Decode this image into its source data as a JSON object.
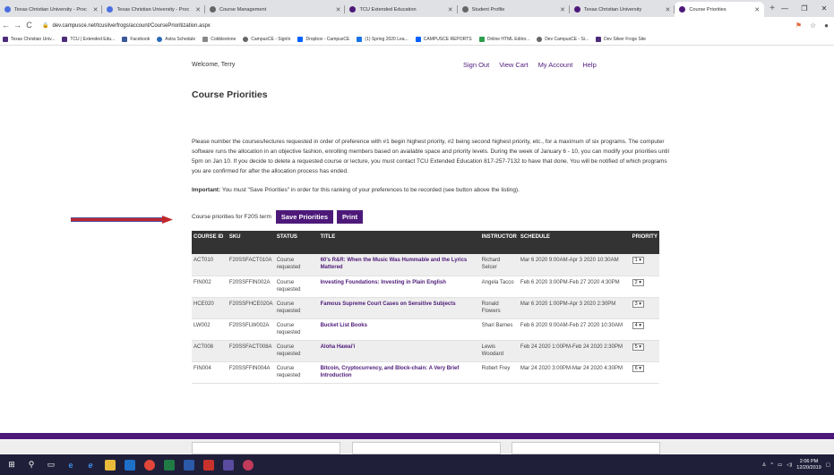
{
  "browser": {
    "tabs": [
      {
        "label": "Texas Christian University - Proc",
        "active": false
      },
      {
        "label": "Texas Christian University - Proc",
        "active": false
      },
      {
        "label": "Course Management",
        "active": false
      },
      {
        "label": "TCU Extended Education",
        "active": false
      },
      {
        "label": "Student Profile",
        "active": false
      },
      {
        "label": "Texas Christian University",
        "active": false
      },
      {
        "label": "Course Priorities",
        "active": true
      }
    ],
    "url": "dev.campusce.net/tcusilverfrogs/account/CoursePrioritization.aspx",
    "bookmarks": [
      "Texas Christian Univ...",
      "TCU | Extended Edu...",
      "Facebook",
      "Astra Schedule",
      "Cobblestone",
      "CampusCE - SignIn",
      "Dropbox - CampusCE",
      "(1) Spring 2020 Lea...",
      "CAMPUSCE REPORTS",
      "Online HTML Editor...",
      "Dev CampusCE - Si...",
      "Dev Silver Frogs Site"
    ]
  },
  "header": {
    "welcome": "Welcome, Terry",
    "nav": [
      "Sign Out",
      "View Cart",
      "My Account",
      "Help"
    ]
  },
  "page": {
    "title": "Course Priorities",
    "intro": "Please number the courses/lectures requested in order of preference with #1 begin highest priority, #2 being second highest priority, etc., for a maximum of six programs. The computer software runs the allocation in an objective fashion, enrolling members based on available space and priority levels. During the week of January 6 - 10, you can modify your priorities until 5pm on Jan 10. If you decide to delete a requested course or lecture, you must contact TCU Extended Education 817-257-7132 to have that done. You will be notified of which programs you are confirmed for after the allocation process has ended.",
    "important_label": "Important:",
    "important_text": " You must \"Save Priorities\" in order for this ranking of your preferences to be recorded (see button above the listing).",
    "priorities_label": "Course priorities for F20S term",
    "save_button": "Save Priorities",
    "print_button": "Print"
  },
  "table": {
    "headers": [
      "COURSE ID",
      "SKU",
      "STATUS",
      "TITLE",
      "INSTRUCTOR",
      "SCHEDULE",
      "PRIORITY"
    ],
    "rows": [
      {
        "id": "ACT010",
        "sku": "F20SSFACT010A",
        "status": "Course requested",
        "title": "60's R&R: When the Music Was Hummable and the Lyrics Mattered",
        "instructor": "Richard Selcer",
        "schedule": "Mar 6 2020 9:00AM-Apr 3 2020 10:30AM",
        "priority": "1"
      },
      {
        "id": "FIN002",
        "sku": "F20SSFFIN002A",
        "status": "Course requested",
        "title": "Investing Foundations: Investing in Plain English",
        "instructor": "Angela Tacco",
        "schedule": "Feb 6 2020 3:00PM-Feb 27 2020 4:30PM",
        "priority": "2"
      },
      {
        "id": "HCE020",
        "sku": "F20SSFHCE020A",
        "status": "Course requested",
        "title": "Famous Supreme Court Cases on Sensitive Subjects",
        "instructor": "Ronald Flowers",
        "schedule": "Mar 6 2020 1:00PM-Apr 3 2020 2:30PM",
        "priority": "3"
      },
      {
        "id": "LW002",
        "sku": "F20SSFLW002A",
        "status": "Course requested",
        "title": "Bucket List Books",
        "instructor": "Shari Barnes",
        "schedule": "Feb 6 2020 9:00AM-Feb 27 2020 10:30AM",
        "priority": "4"
      },
      {
        "id": "ACT008",
        "sku": "F20SSFACT008A",
        "status": "Course requested",
        "title": "Aloha Hawai'i",
        "instructor": "Lewis Woodard",
        "schedule": "Feb 24 2020 1:00PM-Feb 24 2020 2:30PM",
        "priority": "5"
      },
      {
        "id": "FIN004",
        "sku": "F20SSFFIN004A",
        "status": "Course requested",
        "title": "Bitcoin, Cryptocurrency, and Block-chain: A Very Brief Introduction",
        "instructor": "Robert Frey",
        "schedule": "Mar 24 2020 3:00PM-Mar 24 2020 4:30PM",
        "priority": "6"
      }
    ]
  },
  "taskbar": {
    "time": "2:06 PM",
    "date": "12/20/2019"
  },
  "colors": {
    "brand": "#4d1979",
    "arrow": "#c0282d"
  }
}
